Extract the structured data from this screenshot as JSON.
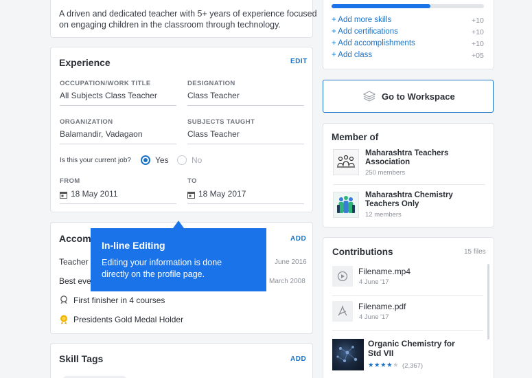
{
  "about": {
    "text_line1": "A driven and dedicated teacher with 5+ years of experience focused",
    "text_line2": "on engaging children in the classroom through technology."
  },
  "experience": {
    "title": "Experience",
    "edit_label": "EDIT",
    "occupation_label": "OCCUPATION/WORK TITLE",
    "occupation_value": "All Subjects Class Teacher",
    "designation_label": "DESIGNATION",
    "designation_value": "Class Teacher",
    "organization_label": "ORGANIZATION",
    "organization_value": "Balamandir, Vadagaon",
    "subjects_label": "SUBJECTS TAUGHT",
    "subjects_value": "Class Teacher",
    "current_job_question": "Is this your current job?",
    "yes_label": "Yes",
    "no_label": "No",
    "from_label": "FROM",
    "from_value": "18 May 2011",
    "to_label": "TO",
    "to_value": "18 May 2017"
  },
  "accomplishments": {
    "title_partial": "Accomp",
    "add_label": "ADD",
    "items": [
      {
        "text": "Teacher o",
        "date": "June 2016"
      },
      {
        "text": "Best ever",
        "date": "March 2008"
      },
      {
        "text": "First finisher in 4 courses",
        "date": ""
      },
      {
        "text": "Presidents Gold Medal Holder",
        "date": ""
      }
    ]
  },
  "tooltip": {
    "title": "In-line Editing",
    "body_line1": "Editing your information is done",
    "body_line2": "directly on the profile page."
  },
  "skill_tags": {
    "title": "Skill Tags",
    "add_label": "ADD"
  },
  "profile_strength": {
    "progress": 0.65,
    "actions": [
      {
        "label": "+ Add more skills",
        "points": "+10"
      },
      {
        "label": "+ Add certifications",
        "points": "+10"
      },
      {
        "label": "+ Add accomplishments",
        "points": "+10"
      },
      {
        "label": "+ Add class",
        "points": "+05"
      }
    ]
  },
  "workspace_button": {
    "label": "Go to Workspace"
  },
  "member_of": {
    "title": "Member of",
    "groups": [
      {
        "name_line1": "Maharashtra Teachers",
        "name_line2": "Association",
        "members": "250 members"
      },
      {
        "name_line1": "Maharashtra Chemistry",
        "name_line2": "Teachers Only",
        "members": "12 members"
      }
    ]
  },
  "contributions": {
    "title": "Contributions",
    "count": "15 files",
    "files": [
      {
        "name": "Filename.mp4",
        "date": "4 June '17"
      },
      {
        "name": "Filename.pdf",
        "date": "4 June '17"
      }
    ],
    "course": {
      "name_line1": "Organic Chemistry for",
      "name_line2": "Std VII",
      "rating_count": "(2,367)",
      "rating": 4
    }
  }
}
